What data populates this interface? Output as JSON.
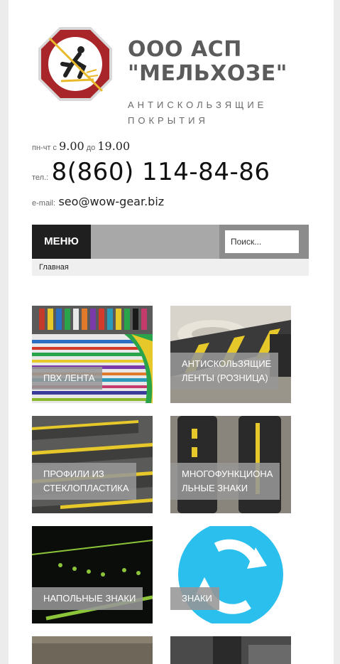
{
  "header": {
    "brand_line1": "ООО АСП",
    "brand_line2": "\"МЕЛЬХОЗЕ\"",
    "tagline_line1": "АНТИСКОЛЬЗЯЩИЕ",
    "tagline_line2": "ПОКРЫТИЯ",
    "logo_icon": "no-slip-sign-icon"
  },
  "contacts": {
    "hours_prefix": "пн-чт с ",
    "hours_from": "9.00",
    "hours_mid": " до ",
    "hours_to": "19.00",
    "phone_label": "тел.:",
    "phone": "8(860) 114-84-86",
    "email_label": "e-mail:",
    "email": "seo@wow-gear.biz"
  },
  "nav": {
    "menu_label": "МЕНЮ",
    "search_placeholder": "Поиск...",
    "breadcrumb": "Главная"
  },
  "tiles": [
    {
      "label": "ПВХ ЛЕНТА"
    },
    {
      "label": "АНТИСКОЛЬЗЯЩИЕ ЛЕНТЫ (РОЗНИЦА)",
      "line1": "АНТИСКОЛЬЗЯЩИЕ",
      "line2": "ЛЕНТЫ (РОЗНИЦА)"
    },
    {
      "label": "ПРОФИЛИ ИЗ СТЕКЛОПЛАСТИКА",
      "line1": "ПРОФИЛИ ИЗ",
      "line2": "СТЕКЛОПЛАСТИКА"
    },
    {
      "label": "МНОГОФУНКЦИОНАЛЬНЫЕ ЗНАКИ",
      "line1": "МНОГОФУНКЦИОНА",
      "line2": "ЛЬНЫЕ ЗНАКИ"
    },
    {
      "label": "НАПОЛЬНЫЕ ЗНАКИ"
    },
    {
      "label": "ЗНАКИ"
    }
  ],
  "colors": {
    "menu_bg": "#1f1f1f",
    "nav_bg": "#a8a8a8",
    "label_bg": "#969696",
    "brand_text": "#5b5b5b"
  }
}
